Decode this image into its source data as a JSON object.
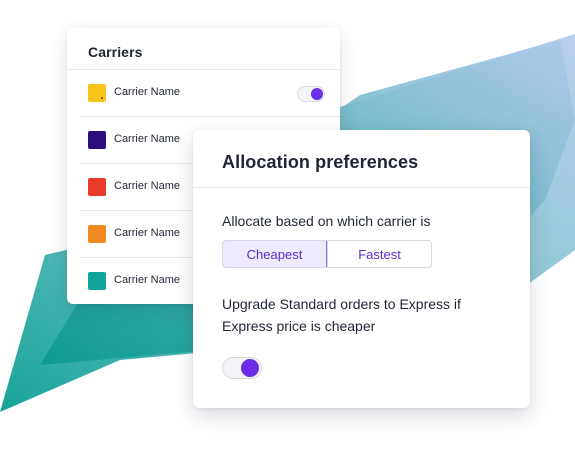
{
  "colors": {
    "accent": "#6a2ee8",
    "teal": "#0f9b94",
    "text": "#1f2533"
  },
  "carriers": {
    "title": "Carriers",
    "items": [
      {
        "name": "Carrier Name",
        "color": "#f7c51a",
        "toggle_on": true
      },
      {
        "name": "Carrier Name",
        "color": "#2b0d7c"
      },
      {
        "name": "Carrier Name",
        "color": "#e83a2a"
      },
      {
        "name": "Carrier Name",
        "color": "#f28a22"
      },
      {
        "name": "Carrier Name",
        "color": "#10a49b"
      }
    ]
  },
  "allocation": {
    "title": "Allocation preferences",
    "question": "Allocate based on which carrier is",
    "options": [
      "Cheapest",
      "Fastest"
    ],
    "selected": "Cheapest",
    "upgrade_text": "Upgrade Standard orders to Express if Express price is cheaper",
    "upgrade_enabled": true
  }
}
